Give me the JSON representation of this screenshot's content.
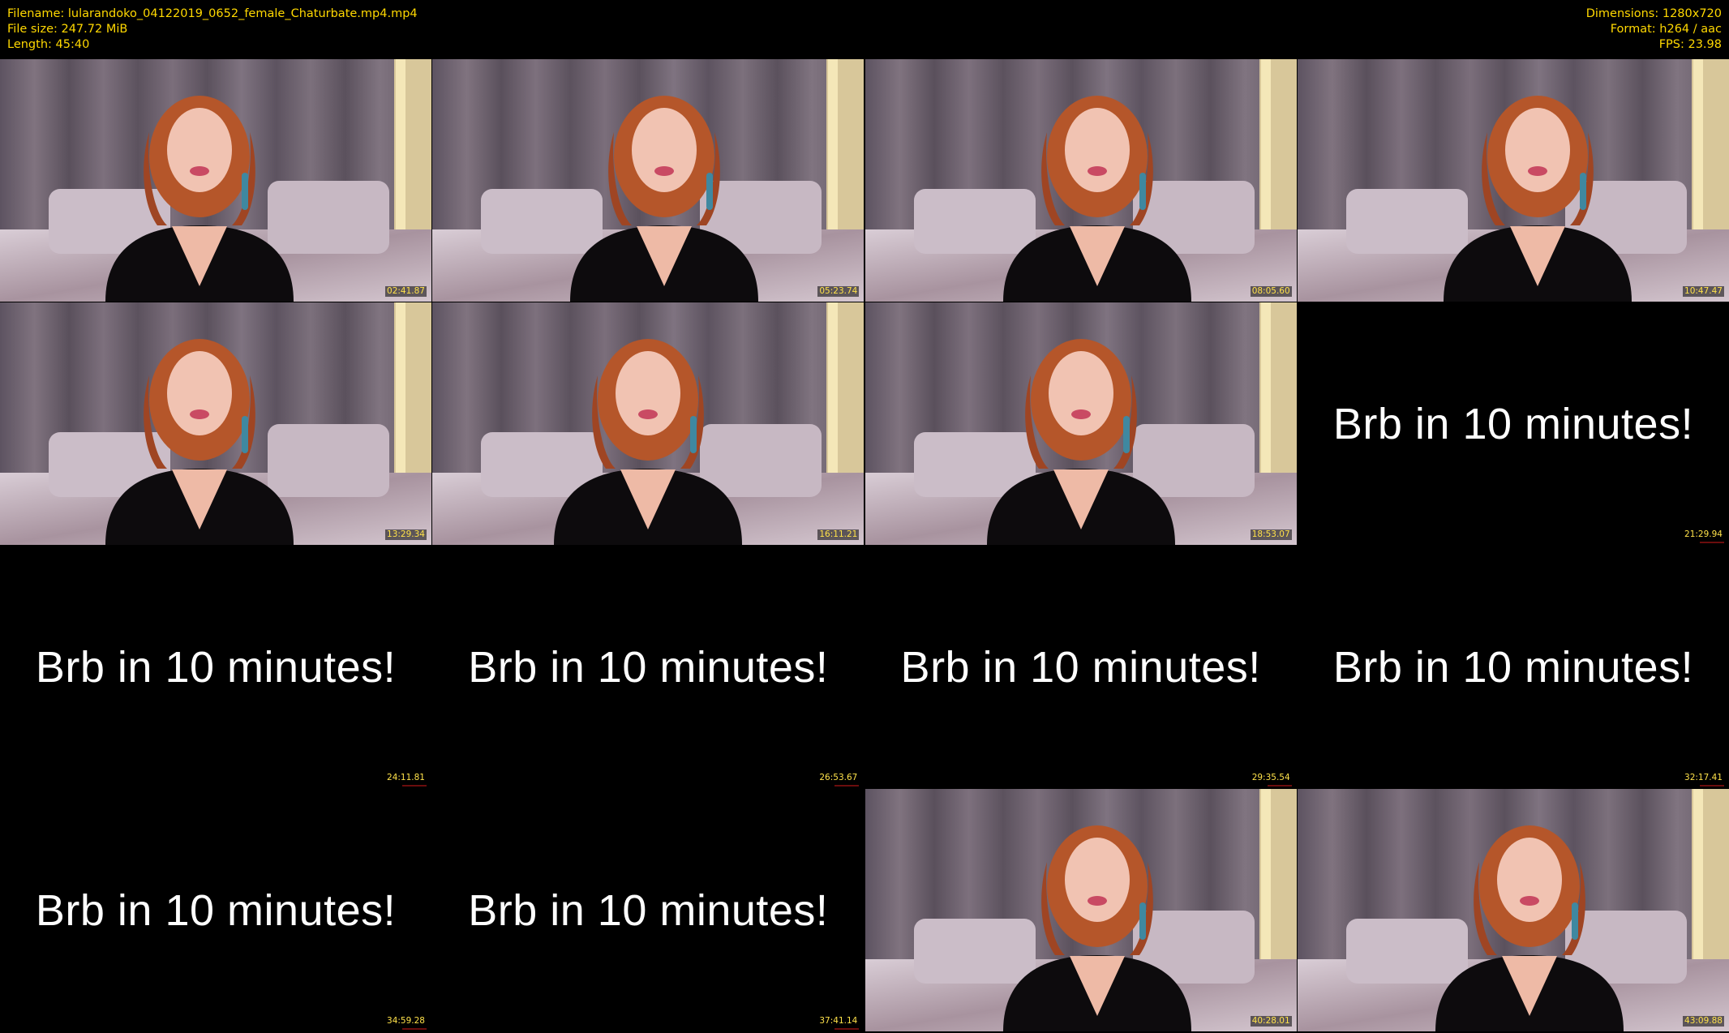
{
  "meta": {
    "filename": "Filename: lularandoko_04122019_0652_female_Chaturbate.mp4.mp4",
    "filesize": "File size: 247.72 MiB",
    "length": "Length: 45:40",
    "dimensions": "Dimensions: 1280x720",
    "format": "Format: h264 / aac",
    "fps": "FPS: 23.98"
  },
  "brb_text": "Brb in 10 minutes!",
  "frames": [
    {
      "time": "02:41.87",
      "kind": "cam"
    },
    {
      "time": "05:23.74",
      "kind": "cam"
    },
    {
      "time": "08:05.60",
      "kind": "cam"
    },
    {
      "time": "10:47.47",
      "kind": "cam"
    },
    {
      "time": "13:29.34",
      "kind": "cam"
    },
    {
      "time": "16:11.21",
      "kind": "cam"
    },
    {
      "time": "18:53.07",
      "kind": "cam"
    },
    {
      "time": "21:29.94",
      "kind": "brb"
    },
    {
      "time": "24:11.81",
      "kind": "brb"
    },
    {
      "time": "26:53.67",
      "kind": "brb"
    },
    {
      "time": "29:35.54",
      "kind": "brb"
    },
    {
      "time": "32:17.41",
      "kind": "brb"
    },
    {
      "time": "34:59.28",
      "kind": "brb"
    },
    {
      "time": "37:41.14",
      "kind": "brb"
    },
    {
      "time": "40:28.01",
      "kind": "cam"
    },
    {
      "time": "43:09.88",
      "kind": "cam"
    }
  ],
  "colors": {
    "meta_text": "#ffd800",
    "timestamp": "#ffe24a",
    "curtain": "#6f6470",
    "wall_light": "#e9d6a0",
    "sofa": "#cdbfcc",
    "hair": "#b5562a",
    "skin": "#f1c3b2",
    "top": "#0d0b0d"
  }
}
